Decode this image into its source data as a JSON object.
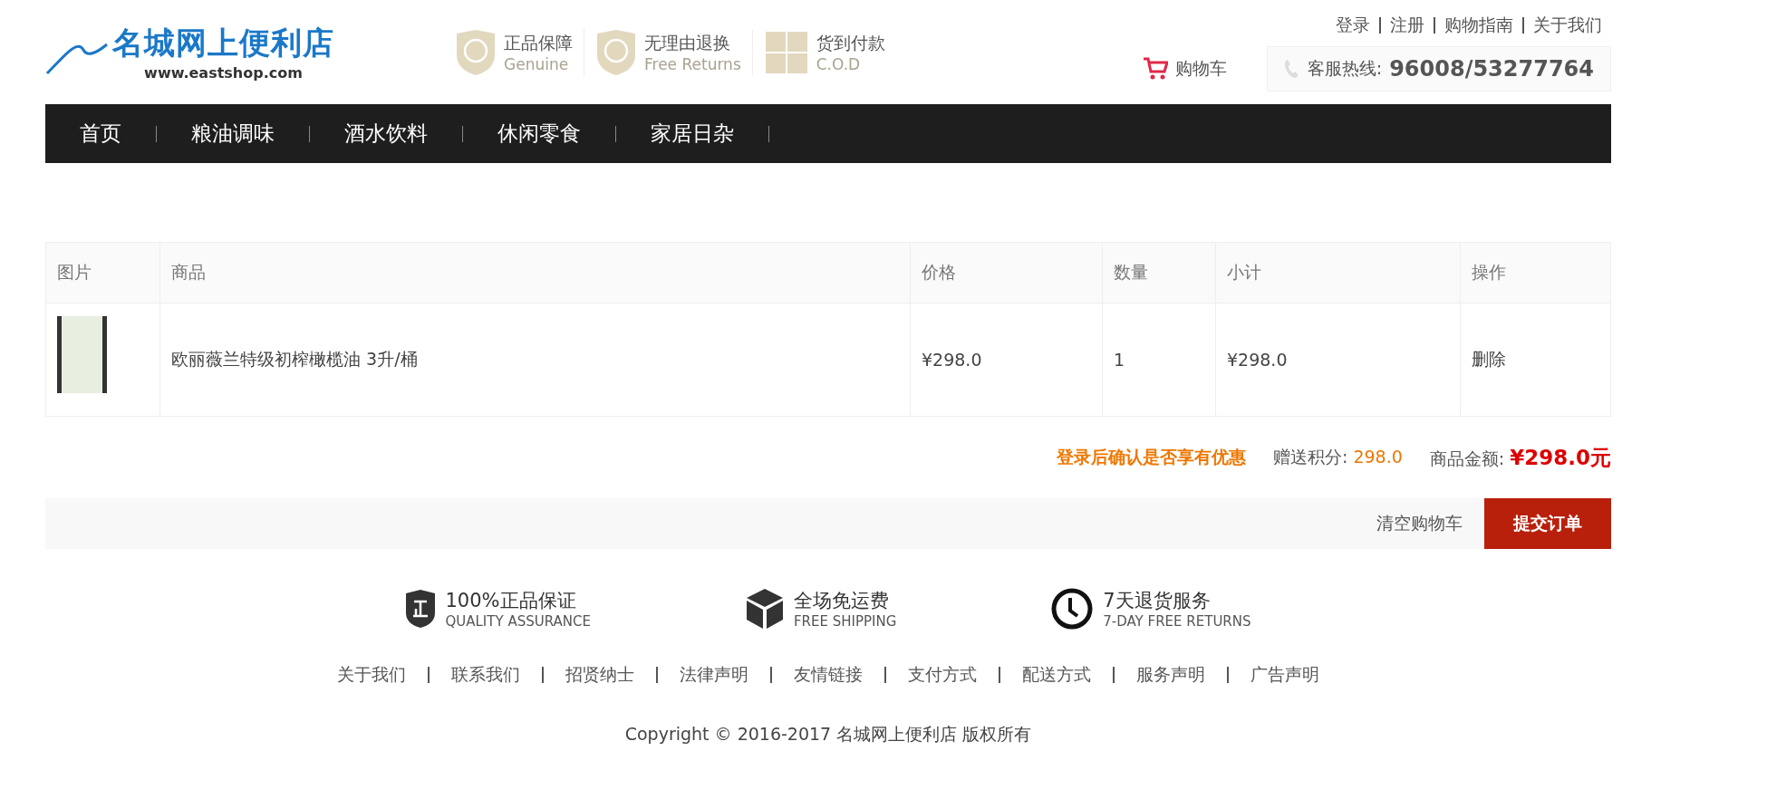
{
  "header": {
    "logo": {
      "name": "名城网上便利店",
      "url": "www.eastshop.com"
    },
    "badges": [
      {
        "kind": "genuine",
        "title": "正品保障",
        "subtitle": "Genuine"
      },
      {
        "kind": "returns",
        "title": "无理由退换",
        "subtitle": "Free Returns"
      },
      {
        "kind": "cod",
        "title": "货到付款",
        "subtitle": "C.O.D"
      }
    ],
    "top_links": [
      "登录",
      "注册",
      "购物指南",
      "关于我们"
    ],
    "cart": "购物车",
    "hotline": {
      "label": "客服热线:",
      "number": "96008/53277764"
    }
  },
  "nav": [
    "首页",
    "粮油调味",
    "酒水饮料",
    "休闲零食",
    "家居日杂"
  ],
  "table": {
    "columns": [
      "图片",
      "商品",
      "价格",
      "数量",
      "小计",
      "操作"
    ],
    "rows": [
      {
        "name": "欧丽薇兰特级初榨橄榄油 3升/桶",
        "price": "¥298.0",
        "quantity": "1",
        "subtotal": "¥298.0",
        "action": "删除"
      }
    ]
  },
  "summary": {
    "notice": "登录后确认是否享有优惠",
    "points_label": "赠送积分:",
    "points": "298.0",
    "amount_label": "商品金额:",
    "amount": "¥298.0元"
  },
  "actions": {
    "clear": "清空购物车",
    "submit": "提交订单"
  },
  "footer": {
    "features": [
      {
        "kind": "quality",
        "title": "100%正品保证",
        "subtitle": "QUALITY ASSURANCE"
      },
      {
        "kind": "shipping",
        "title": "全场免运费",
        "subtitle": "FREE SHIPPING"
      },
      {
        "kind": "returns",
        "title": "7天退货服务",
        "subtitle": "7-DAY FREE RETURNS"
      }
    ],
    "links": [
      "关于我们",
      "联系我们",
      "招贤纳士",
      "法律声明",
      "友情链接",
      "支付方式",
      "配送方式",
      "服务声明",
      "广告声明"
    ],
    "copyright": "Copyright © 2016-2017 名城网上便利店 版权所有"
  }
}
